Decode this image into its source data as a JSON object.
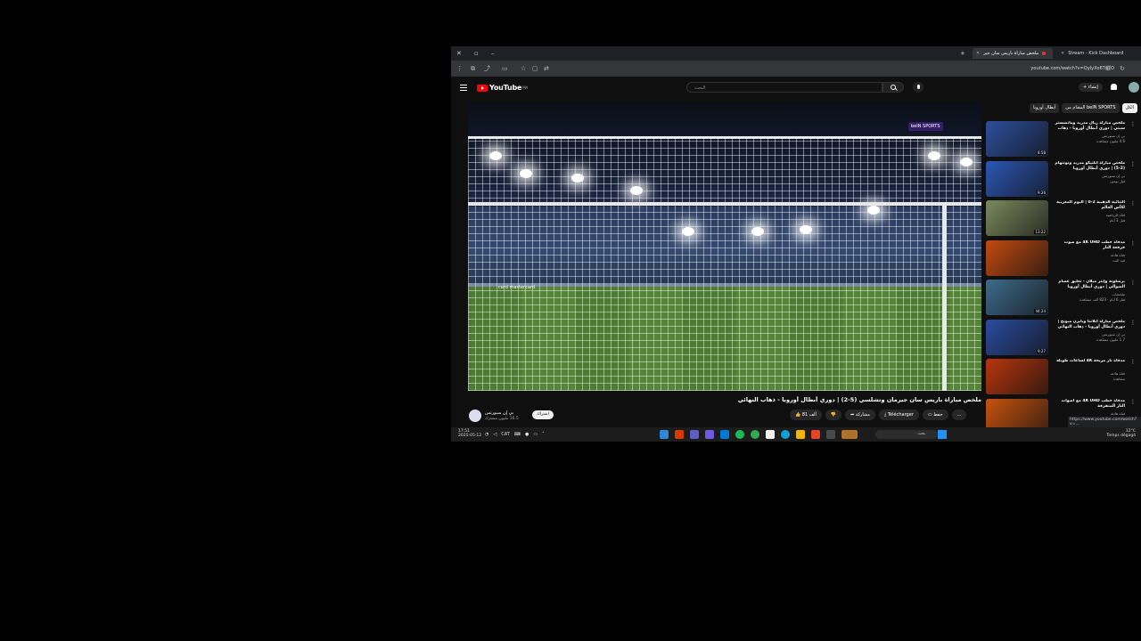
{
  "browser": {
    "tabs": [
      {
        "title": "ملخص مباراة باريس سان جير",
        "active": true
      },
      {
        "title": "Stream - Kick Dashboard",
        "active": false
      }
    ],
    "url": "youtube.com/watch?v=QyIyXo6TgTO"
  },
  "youtube": {
    "logo_text": "YouTube",
    "logo_region": "MA",
    "search_placeholder": "البحث",
    "create_label": "+ إنشاء"
  },
  "video": {
    "overlay_logo": "beIN SPORTS",
    "ad_text": "card  mastercard",
    "title": "ملخص مباراة باريس سان جيرمان وتشلسي (5-2) | دوري أبطال أوروبا - ذهاب النهائي",
    "channel_name": "بي إن سبورتس",
    "channel_subs": "16.5 مليون مشترك",
    "subscribe_label": "اشتراك",
    "like_label": "81 ألف",
    "share_label": "مشاركة",
    "download_label": "Télécharger",
    "save_label": "حفظ",
    "more_label": "..."
  },
  "chips": [
    {
      "label": "الكل",
      "selected": true
    },
    {
      "label": "beIN SPORTS المقدّم من",
      "selected": false
    },
    {
      "label": "أبطال أوروبا",
      "selected": false
    }
  ],
  "recommendations": [
    {
      "title": "ملخص مباراة ريال مدريد ومانشستر سيتي | دوري أبطال أوروبا - ذهاب النهائي",
      "channel": "بي إن سبورتس",
      "meta": "4.6 مليون مشاهدة",
      "duration": "8:58",
      "color": "#2c4f9c"
    },
    {
      "title": "ملخص مباراة أتلتيكو مدريد وتوتنهام (2-5) | دوري أبطال أوروبا",
      "channel": "بي إن سبورتس",
      "meta": "قبل يومين",
      "duration": "9:26",
      "color": "#2b57b5"
    },
    {
      "title": "الثنائية الذهبية 2-0 | اليوم المغربية لكأس العالم",
      "channel": "قناة الرياضية",
      "meta": "قبل 3 أيام",
      "duration": "13:22",
      "color": "#7c8a5e"
    },
    {
      "title": "مدفأة حطب 4K UHD مع صوت فرقعة النار",
      "channel": "قناة هادئة",
      "meta": "قيد البث",
      "duration": "",
      "color": "#c24a10"
    },
    {
      "title": "برشلونة وإنتر ميلان - تعليق عصام الشوالي | دوري أبطال أوروبا",
      "channel": "ملخصات",
      "meta": "قبل 6 أيام · 823 ألف مشاهدة",
      "duration": "44:24",
      "color": "#3d6a8a"
    },
    {
      "title": "ملخص مباراة أتلانتا وبايرن ميونخ | دوري أبطال أوروبا - ذهاب النهائي",
      "channel": "بي إن سبورتس",
      "meta": "1.7 مليون مشاهدة",
      "duration": "9:27",
      "color": "#2a4b9e"
    },
    {
      "title": "مدفأة نار مريحة 4K لساعات طويلة",
      "channel": "قناة هادئة",
      "meta": "مشاهدة",
      "duration": "",
      "color": "#b8360c"
    },
    {
      "title": "مدفأة حطب 4K UHD مع أصوات النار المتفرقة",
      "channel": "قناة هادئة",
      "meta": "قيد البث",
      "duration": "",
      "color": "#c7520e"
    }
  ],
  "status_url": "https://www.youtube.com/watch?v=...",
  "taskbar": {
    "time": "17:51",
    "date": "2025-05-12",
    "lang": "CAT",
    "search_placeholder": "بحث",
    "temp": "12°C",
    "weather": "Temps dégagé"
  }
}
